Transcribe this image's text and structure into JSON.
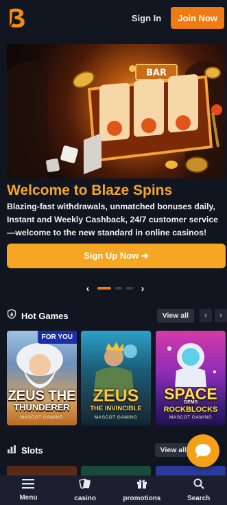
{
  "header": {
    "logo_letter": "B",
    "signin_label": "Sign In",
    "join_label": "Join Now"
  },
  "hero": {
    "title": "Welcome to Blaze Spins",
    "description": "Blazing-fast withdrawals, unmatched bonuses daily, Instant and Weekly Cashback, 24/7 customer service—welcome to the new standard in online casinos!",
    "slot_sign": "BAR",
    "cta_label": "Sign Up Now ➔",
    "carousel_count": 3,
    "carousel_active": 0
  },
  "hot_games": {
    "title": "Hot Games",
    "view_all_label": "View all",
    "cards": [
      {
        "line1": "ZEUS THE",
        "line2": "THUNDERER",
        "maker": "MASCOT GAMING",
        "badge": "FOR YOU"
      },
      {
        "line1": "ZEUS",
        "line2": "THE INVINCIBLE",
        "maker": "MASCOT GAMING"
      },
      {
        "line1": "SPACE",
        "line2": "GEMS",
        "line3": "ROCKBLOCKS",
        "maker": "MASCOT GAMING"
      }
    ]
  },
  "slots": {
    "title": "Slots",
    "view_all_label": "View all"
  },
  "bottom_nav": [
    {
      "label": "Menu",
      "icon": "menu-icon"
    },
    {
      "label": "casino",
      "icon": "cards-icon"
    },
    {
      "label": "promotions",
      "icon": "gift-icon"
    },
    {
      "label": "Search",
      "icon": "search-icon"
    }
  ],
  "colors": {
    "brand_orange": "#f27a12",
    "accent_yellow": "#f5a623",
    "background": "#111520"
  }
}
